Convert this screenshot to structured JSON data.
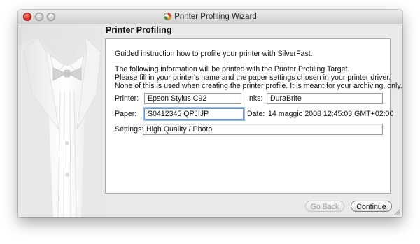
{
  "window": {
    "title": "Printer Profiling Wizard",
    "icon": "silverfast-app-icon"
  },
  "page": {
    "heading": "Printer Profiling",
    "intro": "Guided instruction how to profile your printer with SilverFast.",
    "info_lines": [
      "The following information will be printed with the Printer Profiling Target.",
      "Please fill in your printer's name and the paper settings chosen in your printer driver.",
      "None of this is used when creating the printer profile. It is meant for your archiving, only."
    ]
  },
  "form": {
    "printer_label": "Printer:",
    "printer_value": "Epson Stylus C92",
    "inks_label": "Inks:",
    "inks_value": "DuraBrite",
    "paper_label": "Paper:",
    "paper_value": "S0412345 QPJIJP",
    "date_label": "Date:",
    "date_value": "14 maggio 2008 12:45:03 GMT+02:00",
    "settings_label": "Settings:",
    "settings_value": "High Quality / Photo"
  },
  "buttons": {
    "back_label": "Go Back",
    "back_enabled": false,
    "continue_label": "Continue"
  },
  "colors": {
    "close_button": "#d8281c",
    "focus_ring": "#9bbde8"
  }
}
